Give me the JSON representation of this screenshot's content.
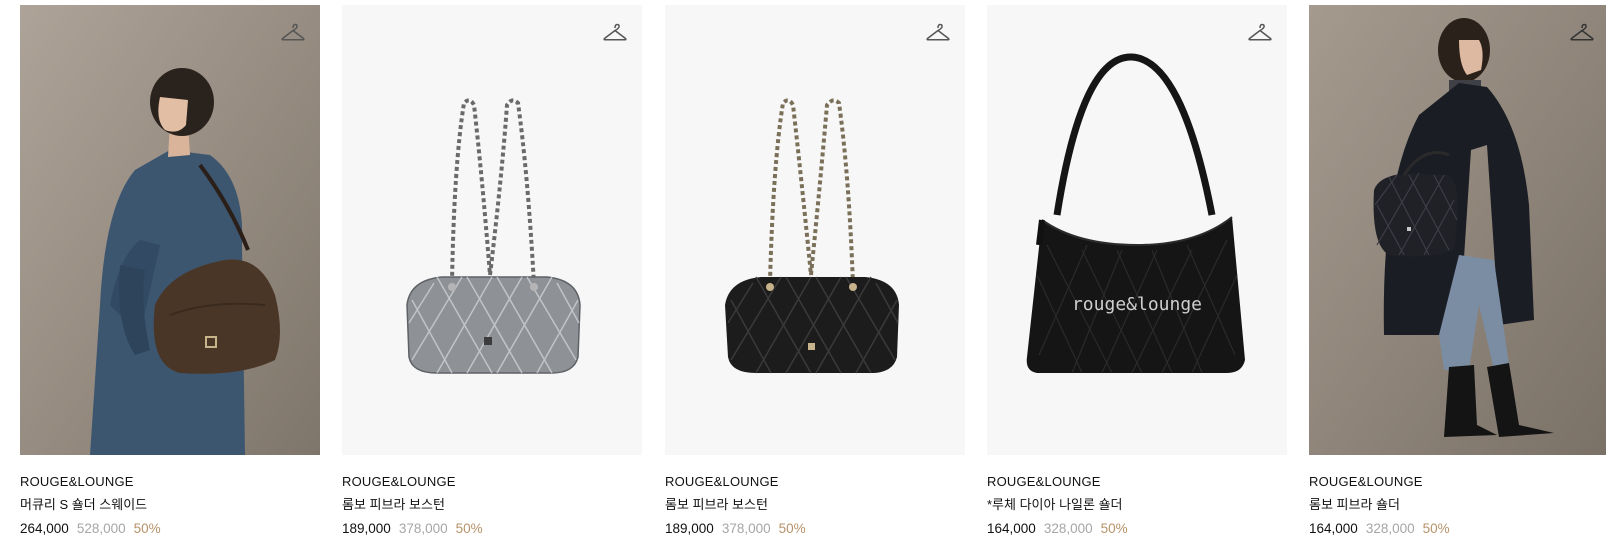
{
  "products": [
    {
      "brand": "ROUGE&LOUNGE",
      "name": "머큐리 S 숄더 스웨이드",
      "sale_price": "264,000",
      "original_price": "528,000",
      "discount": "50%",
      "image": "model-denim-jacket-brown-suede-bag",
      "wishlist_icon": "hanger-icon"
    },
    {
      "brand": "ROUGE&LOUNGE",
      "name": "롬보 피브라 보스턴",
      "sale_price": "189,000",
      "original_price": "378,000",
      "discount": "50%",
      "image": "silver-quilted-boston-bag",
      "wishlist_icon": "hanger-icon"
    },
    {
      "brand": "ROUGE&LOUNGE",
      "name": "롬보 피브라 보스턴",
      "sale_price": "189,000",
      "original_price": "378,000",
      "discount": "50%",
      "image": "black-quilted-boston-bag",
      "wishlist_icon": "hanger-icon"
    },
    {
      "brand": "ROUGE&LOUNGE",
      "name": "*루체 다이아 나일론 숄더",
      "sale_price": "164,000",
      "original_price": "328,000",
      "discount": "50%",
      "image": "black-nylon-shoulder-bag",
      "bag_print": "rouge&lounge",
      "wishlist_icon": "hanger-icon"
    },
    {
      "brand": "ROUGE&LOUNGE",
      "name": "롬보 피브라 숄더",
      "sale_price": "164,000",
      "original_price": "328,000",
      "discount": "50%",
      "image": "model-black-coat-quilted-bag",
      "wishlist_icon": "hanger-icon"
    }
  ],
  "colors": {
    "discount": "#b7926a",
    "original_price": "#a6a6a6",
    "text": "#111111"
  }
}
